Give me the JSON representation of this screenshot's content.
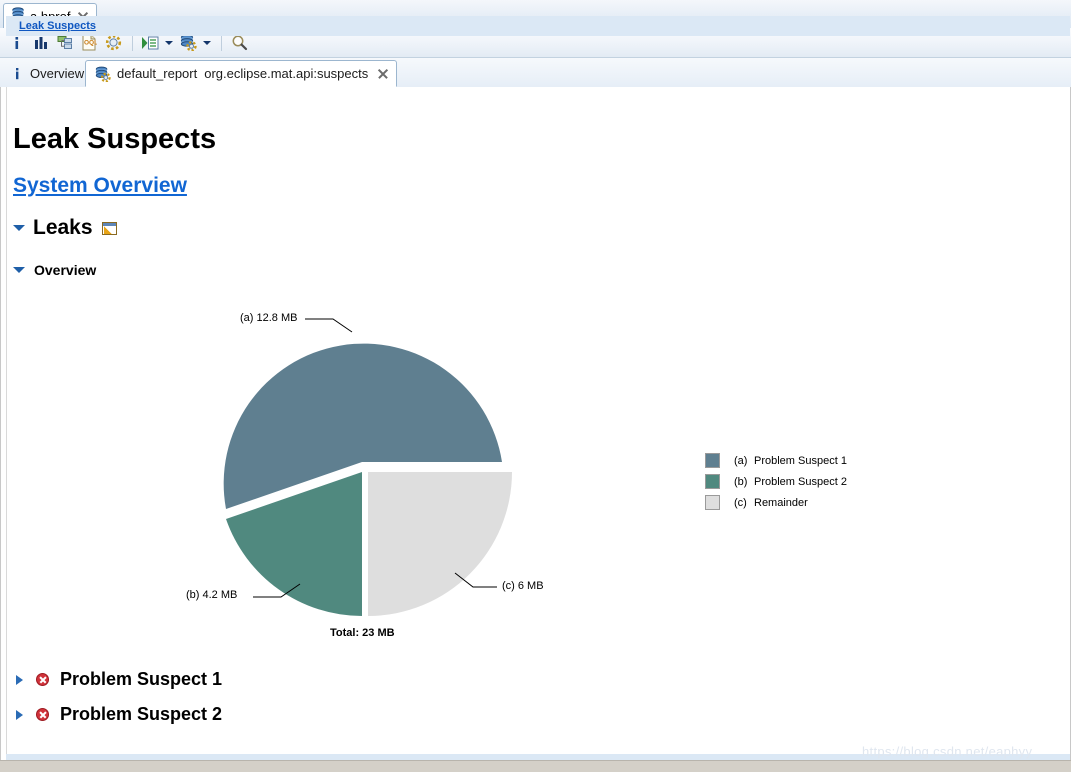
{
  "window": {
    "editor_tab": {
      "label": "a.hprof",
      "icon": "heap-dump-icon",
      "close": "close-icon"
    }
  },
  "toolbar": {
    "buttons": [
      {
        "name": "overview-info-button",
        "icon": "info-icon",
        "tooltip": "Overview"
      },
      {
        "name": "histogram-button",
        "icon": "histogram-icon",
        "tooltip": "Histogram"
      },
      {
        "name": "dominator-tree-button",
        "icon": "tree-icon",
        "tooltip": "Dominator Tree"
      },
      {
        "name": "oql-button",
        "icon": "oql-document-icon",
        "tooltip": "OQL"
      },
      {
        "name": "inspector-button",
        "icon": "gear-icon",
        "tooltip": "Calculate Retained Size"
      },
      {
        "name": "run-query-button",
        "icon": "run-list-icon",
        "tooltip": "Queries"
      },
      {
        "name": "reports-button",
        "icon": "database-gear-icon",
        "tooltip": "Reports"
      },
      {
        "name": "search-button",
        "icon": "search-icon",
        "tooltip": "Find"
      }
    ]
  },
  "subtabs": [
    {
      "name": "tab-overview",
      "label": "Overview",
      "icon": "info-icon",
      "active": false,
      "closable": false
    },
    {
      "name": "tab-default-report",
      "label": "default_report",
      "label2": "org.eclipse.mat.api:suspects",
      "icon": "database-gear-icon",
      "active": true,
      "closable": true
    }
  ],
  "report": {
    "breadcrumb": "Leak Suspects",
    "title": "Leak Suspects",
    "system_overview_link": "System Overview",
    "sections": {
      "leaks": "Leaks",
      "overview": "Overview"
    },
    "suspects": [
      {
        "label": "Problem Suspect 1"
      },
      {
        "label": "Problem Suspect 2"
      }
    ]
  },
  "chart_data": {
    "type": "pie",
    "title": "",
    "total_label": "Total: 23 MB",
    "legend_position": "right",
    "labels": [
      "(a)  12.8 MB",
      "(b)  4.2 MB",
      "(c)  6 MB"
    ],
    "categories": [
      "Problem Suspect 1",
      "Problem Suspect 2",
      "Remainder"
    ],
    "keys": [
      "(a)",
      "(b)",
      "(c)"
    ],
    "values": [
      12.8,
      4.2,
      6
    ],
    "unit": "MB",
    "total": 23,
    "colors": [
      "#5f7f90",
      "#50897f",
      "#dedede"
    ],
    "legend": [
      {
        "key": "(a)",
        "label": "Problem Suspect 1",
        "color": "#5f7f90"
      },
      {
        "key": "(b)",
        "label": "Problem Suspect 2",
        "color": "#50897f"
      },
      {
        "key": "(c)",
        "label": "Remainder",
        "color": "#dedede"
      }
    ]
  },
  "watermark": "https://blog.csdn.net/eaphyy"
}
